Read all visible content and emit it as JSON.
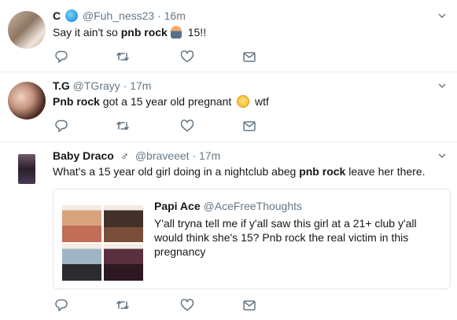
{
  "tweets": [
    {
      "name": "C",
      "handle": "@Fuh_ness23",
      "time": "16m",
      "text_before": "Say it ain't so ",
      "text_bold": "pnb rock",
      "text_after": " 15!!"
    },
    {
      "name": "T.G",
      "handle": "@TGrayy",
      "time": "17m",
      "text_bold": "Pnb rock",
      "text_after": " got a 15 year old pregnant ",
      "text_end": " wtf"
    },
    {
      "name": "Baby Draco",
      "handle": "@braveeet",
      "time": "17m",
      "text_before": "What's a 15 year old girl doing in a nightclub abeg ",
      "text_bold": "pnb rock",
      "text_after": " leave her there.",
      "quote": {
        "name": "Papi Ace",
        "handle": "@AceFreeThoughts",
        "text": "Y'all tryna tell me if y'all saw this girl at a 21+ club y'all would think she's 15? Pnb rock the real victim in this pregnancy"
      }
    }
  ],
  "separator": "·",
  "icons": {
    "reply": "reply-icon",
    "retweet": "retweet-icon",
    "like": "heart-icon",
    "dm": "envelope-icon",
    "menu": "chevron-down-icon"
  },
  "colors": {
    "icon": "#657786",
    "divider": "#e6ecf0",
    "accent": "#1da1f2"
  }
}
